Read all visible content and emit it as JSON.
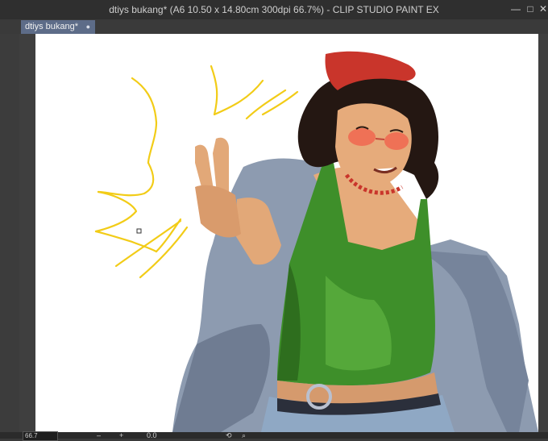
{
  "window": {
    "title": "dtiys bukang* (A6 10.50 x 14.80cm 300dpi 66.7%)  -  CLIP STUDIO PAINT EX",
    "minimize_icon": "minimize-icon",
    "maximize_icon": "maximize-icon",
    "close_icon": "close-icon"
  },
  "tab": {
    "label": "dtiys bukang*",
    "modified_marker": "●"
  },
  "status": {
    "zoom": "66.7",
    "rotation": "0.0"
  },
  "colors": {
    "titlebar": "#2f2f2f",
    "tab": "#5d6c88",
    "workspace": "#3f3f3f",
    "paper": "#ffffff",
    "sketch_yellow": "#f2cc17"
  }
}
